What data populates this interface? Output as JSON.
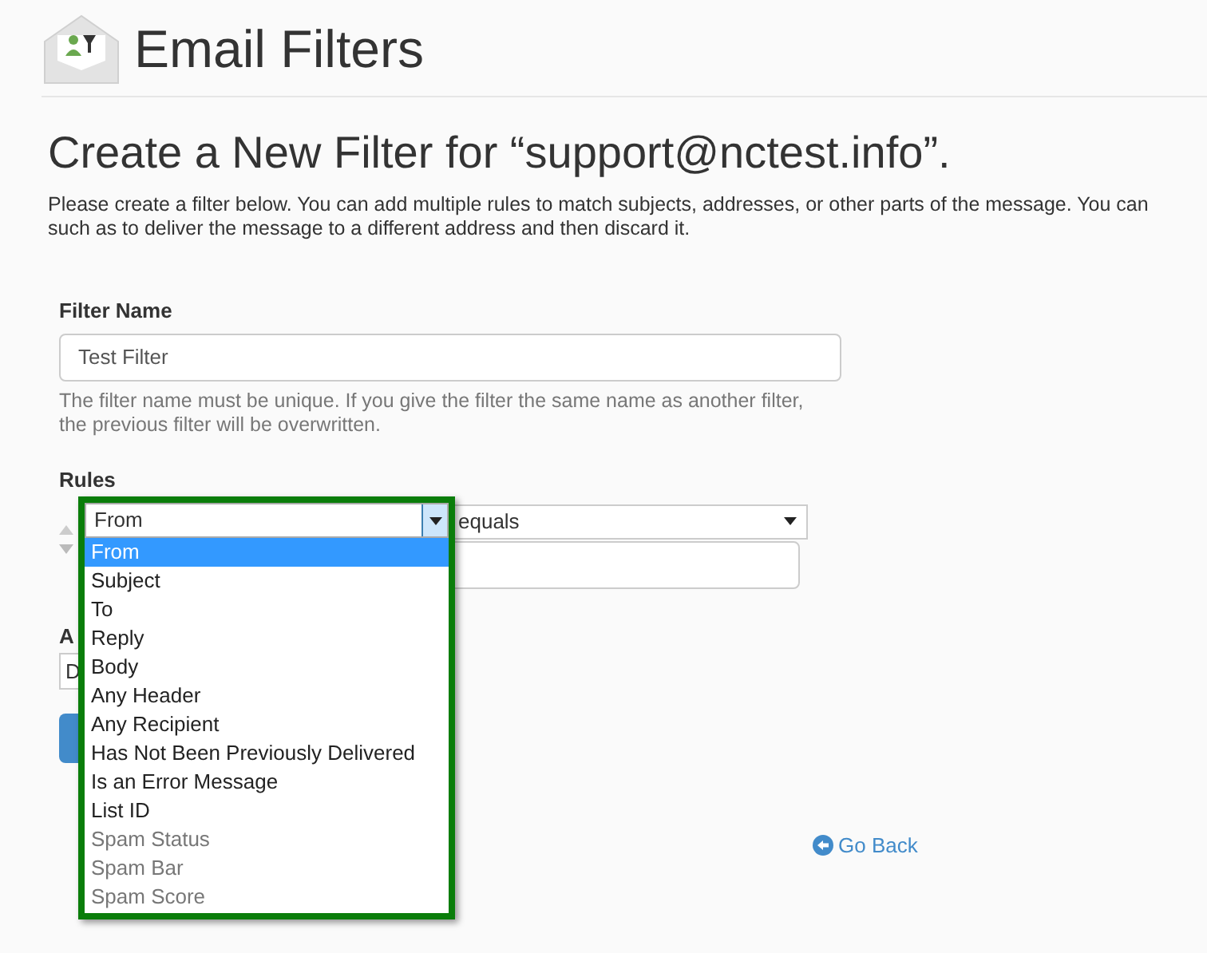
{
  "header": {
    "title": "Email Filters"
  },
  "heading": "Create a New Filter for “support@nctest.info”.",
  "description_lines": [
    "Please create a filter below. You can add multiple rules to match subjects, addresses, or other parts of the message. You can",
    "such as to deliver the message to a different address and then discard it."
  ],
  "filter_name": {
    "label": "Filter Name",
    "value": "Test Filter",
    "help": "The filter name must be unique. If you give the filter the same name as another filter, the previous filter will be overwritten."
  },
  "rules": {
    "label": "Rules",
    "field_select": {
      "value": "From",
      "expanded": true
    },
    "operator_select": {
      "value": "equals"
    },
    "options": [
      {
        "label": "From",
        "selected": true,
        "disabled": false
      },
      {
        "label": "Subject",
        "selected": false,
        "disabled": false
      },
      {
        "label": "To",
        "selected": false,
        "disabled": false
      },
      {
        "label": "Reply",
        "selected": false,
        "disabled": false
      },
      {
        "label": "Body",
        "selected": false,
        "disabled": false
      },
      {
        "label": "Any Header",
        "selected": false,
        "disabled": false
      },
      {
        "label": "Any Recipient",
        "selected": false,
        "disabled": false
      },
      {
        "label": "Has Not Been Previously Delivered",
        "selected": false,
        "disabled": false
      },
      {
        "label": "Is an Error Message",
        "selected": false,
        "disabled": false
      },
      {
        "label": "List ID",
        "selected": false,
        "disabled": false
      },
      {
        "label": "Spam Status",
        "selected": false,
        "disabled": true
      },
      {
        "label": "Spam Bar",
        "selected": false,
        "disabled": true
      },
      {
        "label": "Spam Score",
        "selected": false,
        "disabled": true
      }
    ]
  },
  "actions": {
    "label": "A",
    "select_value": "D"
  },
  "go_back": "Go Back"
}
